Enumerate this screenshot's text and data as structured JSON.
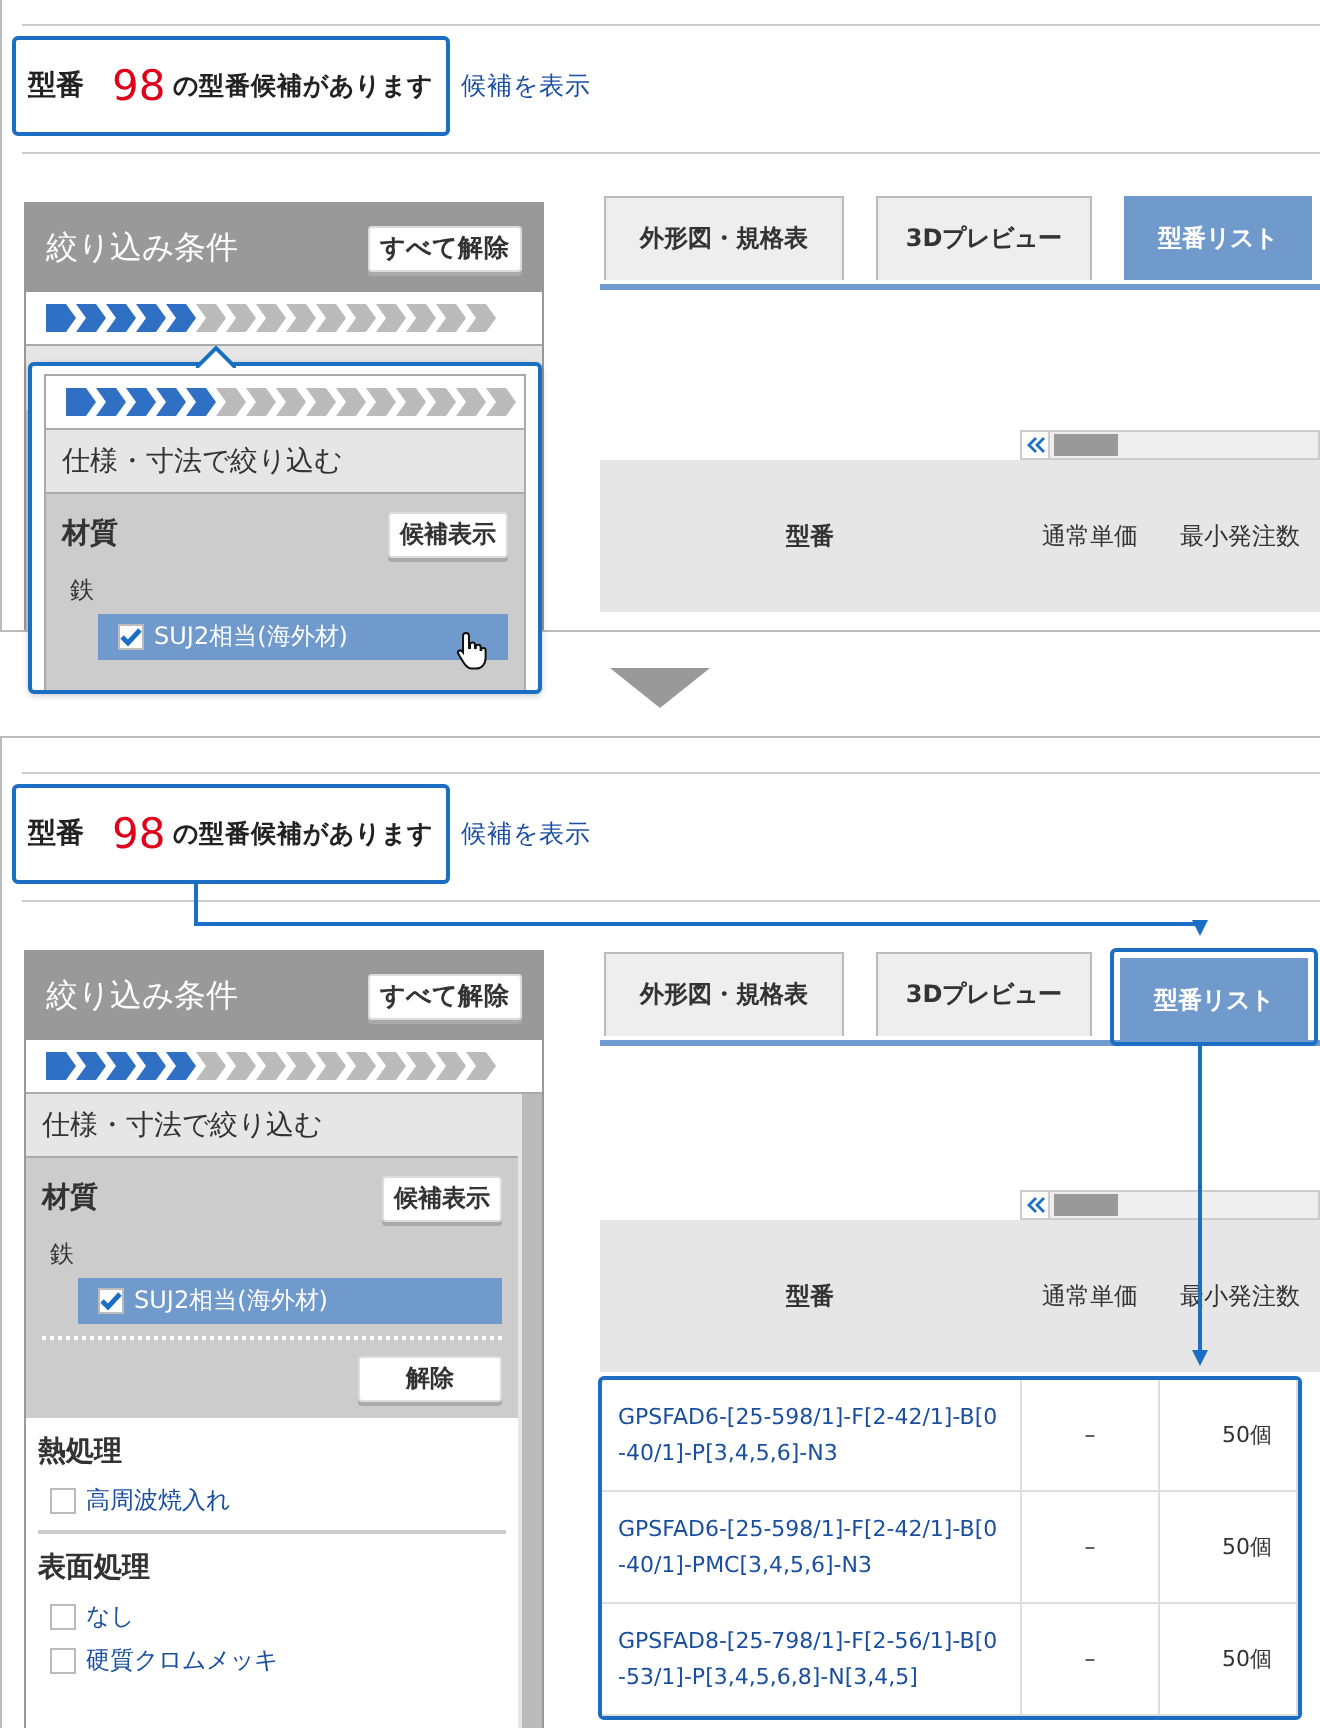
{
  "steps": [
    {
      "header": {
        "prefix": "型番",
        "count": "98",
        "suffix": "の型番候補があります",
        "link": "候補を表示",
        "highlighted": true
      },
      "filter": {
        "title": "絞り込み条件",
        "clear_all": "すべて解除",
        "progress": {
          "level": 0.3333
        },
        "popup": {
          "progress": {
            "level": 0.3333
          },
          "section_title": "仕様・寸法で絞り込む",
          "group": {
            "title": "材質",
            "button": "候補表示",
            "subgroup": "鉄",
            "options": [
              {
                "label": "SUJ2相当(海外材)",
                "checked": true,
                "selected": true,
                "pointer": true
              }
            ]
          }
        }
      },
      "tabs": [
        {
          "label": "外形図・規格表",
          "selected": false,
          "highlighted": false
        },
        {
          "label": "3Dプレビュー",
          "selected": false,
          "highlighted": false
        },
        {
          "label": "型番リスト",
          "selected": true,
          "highlighted": false
        }
      ],
      "table": {
        "columns": [
          "型番",
          "通常単価",
          "最小発注数"
        ]
      }
    },
    {
      "header": {
        "prefix": "型番",
        "count": "98",
        "suffix": "の型番候補があります",
        "link": "候補を表示",
        "highlighted": true
      },
      "filter": {
        "title": "絞り込み条件",
        "clear_all": "すべて解除",
        "progress": {
          "level": 0.3333
        },
        "section_title": "仕様・寸法で絞り込む",
        "groups": [
          {
            "kind": "active",
            "title": "材質",
            "button": "候補表示",
            "subgroup": "鉄",
            "options": [
              {
                "label": "SUJ2相当(海外材)",
                "checked": true,
                "selected": true
              }
            ],
            "clear": "解除"
          },
          {
            "kind": "plain",
            "title": "熱処理",
            "options": [
              {
                "label": "高周波焼入れ",
                "checked": false,
                "selected": false
              }
            ]
          },
          {
            "kind": "plain",
            "title": "表面処理",
            "options": [
              {
                "label": "なし",
                "checked": false,
                "selected": false
              },
              {
                "label": "硬質クロムメッキ",
                "checked": false,
                "selected": false
              }
            ]
          }
        ]
      },
      "tabs": [
        {
          "label": "外形図・規格表",
          "selected": false,
          "highlighted": false
        },
        {
          "label": "3Dプレビュー",
          "selected": false,
          "highlighted": false
        },
        {
          "label": "型番リスト",
          "selected": true,
          "highlighted": true
        }
      ],
      "table": {
        "columns": [
          "型番",
          "通常単価",
          "最小発注数"
        ],
        "highlighted": true,
        "rows": [
          [
            "GPSFAD6-[25-598/1]-F[2-42/1]-B[0-40/1]-P[3,4,5,6]-N3",
            "–",
            "50個"
          ],
          [
            "GPSFAD6-[25-598/1]-F[2-42/1]-B[0-40/1]-PMC[3,4,5,6]-N3",
            "–",
            "50個"
          ],
          [
            "GPSFAD8-[25-798/1]-F[2-56/1]-B[0-53/1]-P[3,4,5,6,8]-N[3,4,5]",
            "–",
            "50個"
          ]
        ]
      },
      "show_connectors": true
    }
  ]
}
